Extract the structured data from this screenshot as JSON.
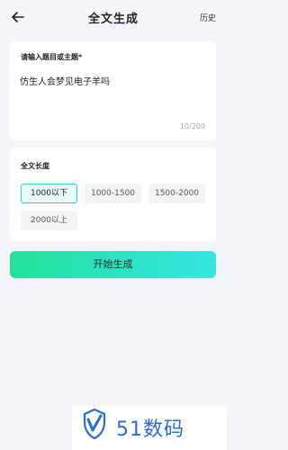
{
  "header": {
    "title": "全文生成",
    "history_label": "历史"
  },
  "topic_card": {
    "label": "请输入题目或主题*",
    "value": "仿生人会梦见电子羊吗",
    "counter": "10/200"
  },
  "length_card": {
    "label": "全文长度",
    "options": [
      {
        "label": "1000以下",
        "selected": true
      },
      {
        "label": "1000-1500",
        "selected": false
      },
      {
        "label": "1500-2000",
        "selected": false
      },
      {
        "label": "2000以上",
        "selected": false
      }
    ]
  },
  "generate_button": "开始生成",
  "watermark": {
    "text": "51数码",
    "color": "#2b6bd6"
  },
  "colors": {
    "accent": "#2ed7c5",
    "button_gradient_start": "#22e29a",
    "button_gradient_end": "#35e6e0"
  }
}
